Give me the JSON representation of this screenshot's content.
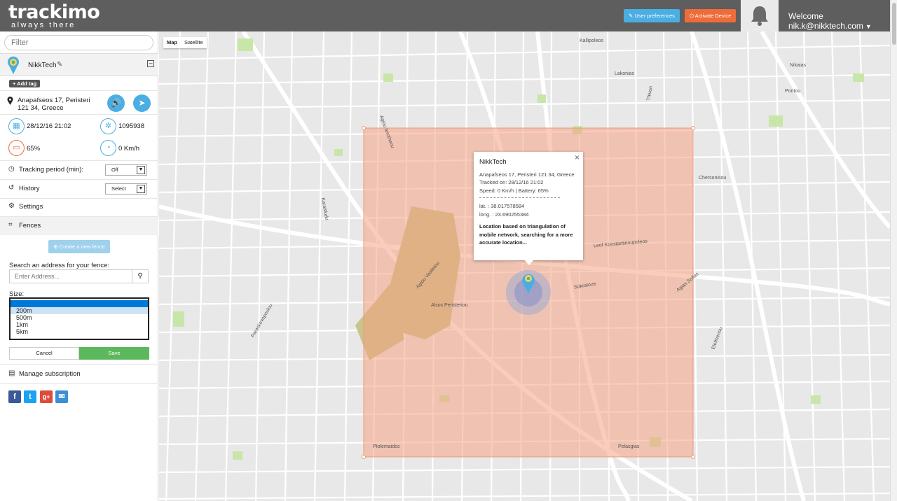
{
  "header": {
    "logo_main": "trackimo",
    "logo_tagline": "always there",
    "user_preferences_label": "User preferences",
    "activate_device_label": "Activate Device",
    "welcome_text": "Welcome nik.k@nikktech.com",
    "brand_colors": {
      "header_bg": "#5e5e5e",
      "accent": "#4aaee3",
      "activate": "#ef6c3a",
      "save": "#5cb85c"
    }
  },
  "sidebar": {
    "filter_placeholder": "Filter",
    "device_name": "NikkTech",
    "add_tag_label": "+ Add tag",
    "address": "Anapafseos 17, Peristeri 121 34, Greece",
    "datetime": "28/12/16 21:02",
    "satellite_id": "1095938",
    "battery": "65%",
    "speed": "0 Km/h",
    "tracking_period_label": "Tracking period (min):",
    "tracking_period_value": "Off",
    "history_label": "History",
    "history_value": "Select",
    "settings_label": "Settings",
    "fences_label": "Fences",
    "create_fence_label": "Create a new fence",
    "search_label": "Search an address for your fence:",
    "search_placeholder": "Enter Address...",
    "size_label": "Size:",
    "size_options": [
      "...",
      "200m",
      "500m",
      "1km",
      "5km"
    ],
    "size_selected": "200m",
    "cancel_label": "Cancel",
    "save_label": "Save",
    "manage_subscription_label": "Manage subscription",
    "social_icons": [
      "facebook-icon",
      "twitter-icon",
      "google-plus-icon",
      "email-icon"
    ]
  },
  "map": {
    "map_button": "Map",
    "satellite_button": "Satellite",
    "fence_color": "#f4a383",
    "popup": {
      "title": "NikkTech",
      "address": "Anapafseos 17, Peristeri 121 34, Greece",
      "tracked_on": "Tracked on: 28/12/16 21:02",
      "speed_battery": "Speed: 0 Km/h | Battery: 65%",
      "lat": "lat. : 38.017578584",
      "long": "long. : 23.690255384",
      "note": "Location based on triangulation of mobile network, searching for a more accurate location..."
    },
    "street_labels": {
      "a": "Agiou Ierotheou",
      "b": "Agiou Vasileiou",
      "c": "Karaiskaki",
      "d": "Thivon",
      "e": "Pelasgias",
      "f": "Ptolemaidos",
      "g": "Alsos Peristeriou",
      "h": "Sokratous",
      "i": "Leof Konstantinoupoleos",
      "j": "Chersonisou",
      "k": "Agias Sofias",
      "l": "Eleftheriou",
      "m": "Kallipoleos",
      "n": "Lakonias",
      "o": "Nikaias",
      "p": "Pontou",
      "q": "Paraskevopoulou"
    }
  }
}
